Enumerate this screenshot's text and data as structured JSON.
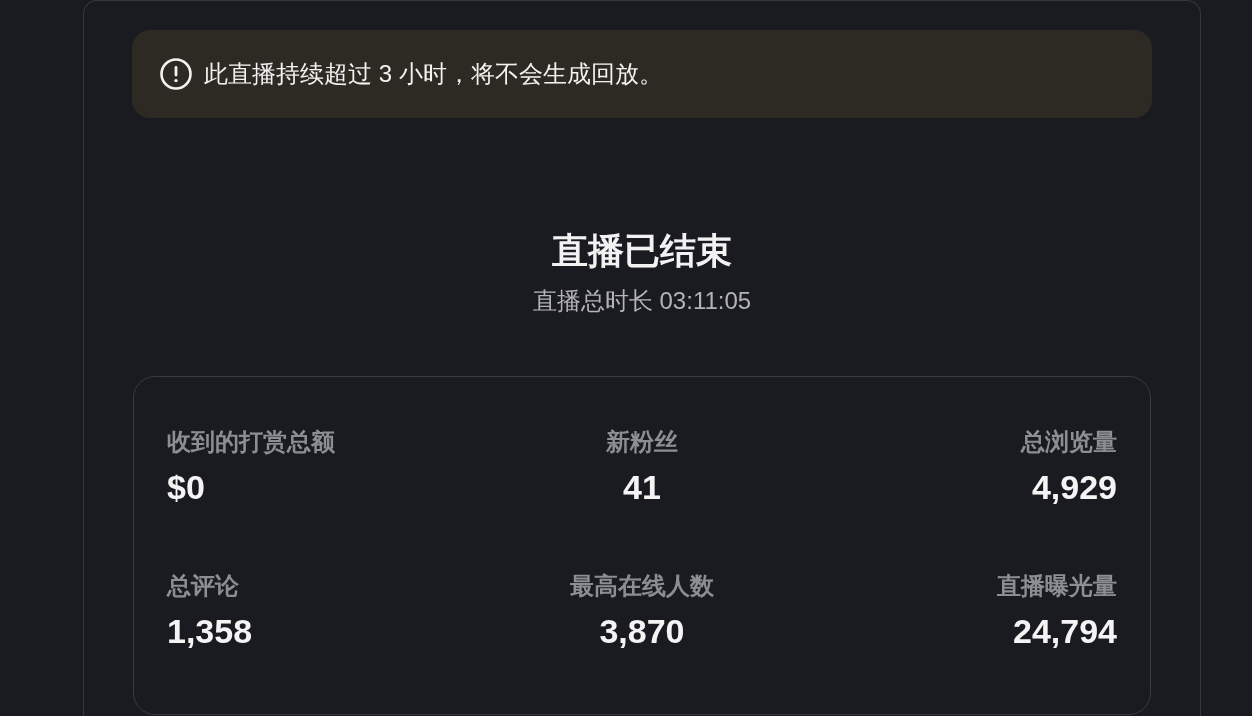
{
  "notice": {
    "text": "此直播持续超过 3 小时，将不会生成回放。"
  },
  "header": {
    "title": "直播已结束",
    "duration": "直播总时长 03:11:05"
  },
  "stats": [
    {
      "label": "收到的打赏总额",
      "value": "$0"
    },
    {
      "label": "新粉丝",
      "value": "41"
    },
    {
      "label": "总浏览量",
      "value": "4,929"
    },
    {
      "label": "总评论",
      "value": "1,358"
    },
    {
      "label": "最高在线人数",
      "value": "3,870"
    },
    {
      "label": "直播曝光量",
      "value": "24,794"
    }
  ]
}
